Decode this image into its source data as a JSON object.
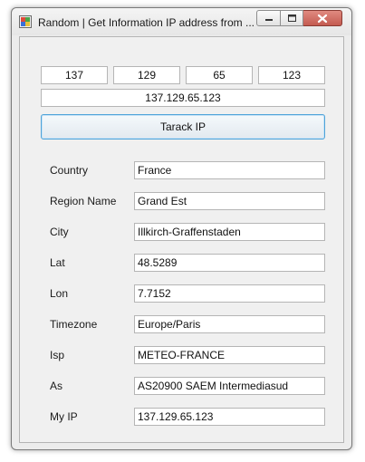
{
  "window": {
    "title": "Random | Get Information IP address from ...",
    "caption_buttons": [
      "minimize",
      "maximize",
      "close"
    ]
  },
  "ip_octets": [
    "137",
    "129",
    "65",
    "123"
  ],
  "ip_full": "137.129.65.123",
  "track_button": "Tarack IP",
  "fields": [
    {
      "label": "Country",
      "value": "France"
    },
    {
      "label": "Region Name",
      "value": "Grand Est"
    },
    {
      "label": "City",
      "value": "Illkirch-Graffenstaden"
    },
    {
      "label": "Lat",
      "value": "48.5289"
    },
    {
      "label": "Lon",
      "value": "7.7152"
    },
    {
      "label": "Timezone",
      "value": "Europe/Paris"
    },
    {
      "label": "Isp",
      "value": "METEO-FRANCE"
    },
    {
      "label": "As",
      "value": "AS20900 SAEM Intermediasud"
    },
    {
      "label": "My IP",
      "value": "137.129.65.123"
    }
  ],
  "colors": {
    "button_border": "#4fa3d9",
    "close_button_bg": "#c45b50"
  }
}
